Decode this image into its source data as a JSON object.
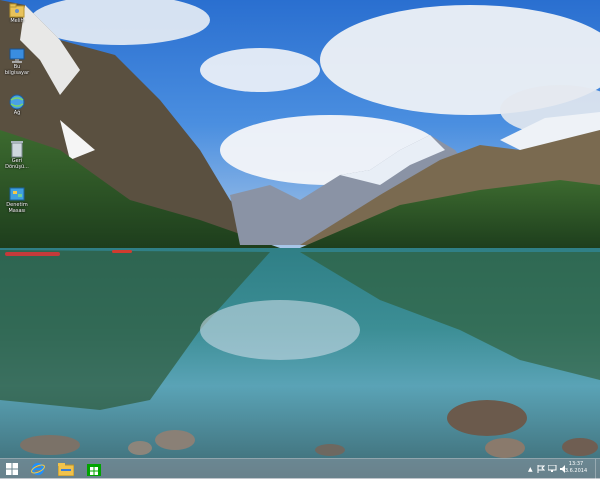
{
  "desktop": {
    "icons": [
      {
        "label": "Melih",
        "icon": "user-folder-icon"
      },
      {
        "label": "Bu bilgisayar",
        "icon": "computer-icon"
      },
      {
        "label": "Ağ",
        "icon": "network-icon"
      },
      {
        "label": "Geri Dönüşü...",
        "icon": "recycle-bin-icon"
      },
      {
        "label": "Denetim Masası",
        "icon": "control-panel-icon"
      }
    ]
  },
  "taskbar": {
    "pinned": [
      {
        "name": "start-button",
        "icon": "windows-logo-icon"
      },
      {
        "name": "internet-explorer-button",
        "icon": "internet-explorer-icon"
      },
      {
        "name": "file-explorer-button",
        "icon": "file-explorer-icon"
      },
      {
        "name": "store-button",
        "icon": "store-icon"
      }
    ],
    "tray": {
      "icons": [
        "show-hidden-icons-arrow",
        "action-center-flag-icon",
        "network-icon",
        "volume-icon"
      ],
      "time": "13:37",
      "date": "3.6.2014"
    }
  },
  "colors": {
    "taskbar": "#8c96a0",
    "accent": "#0078d7"
  }
}
